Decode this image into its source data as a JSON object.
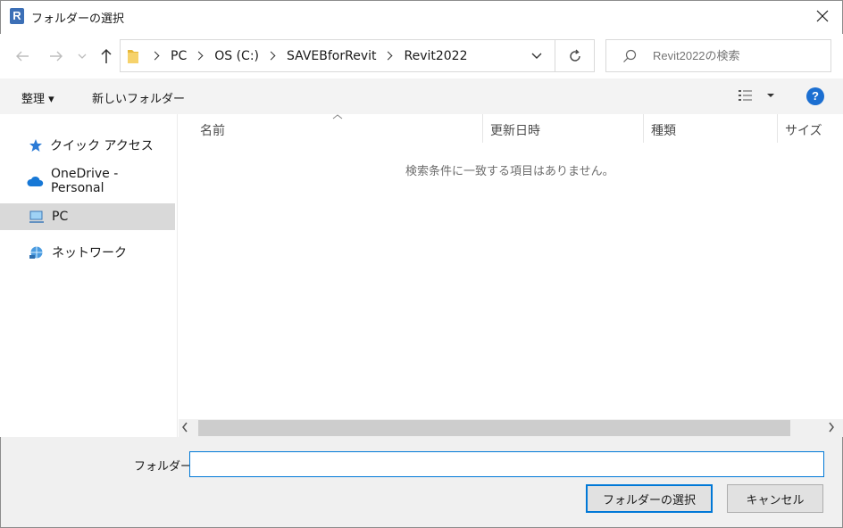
{
  "window": {
    "title": "フォルダーの選択",
    "icon_letter": "R"
  },
  "address": {
    "crumbs": [
      "PC",
      "OS (C:)",
      "SAVEBforRevit",
      "Revit2022"
    ]
  },
  "search": {
    "placeholder": "Revit2022の検索"
  },
  "toolbar": {
    "organize_label": "整理 ▾",
    "new_folder_label": "新しいフォルダー",
    "help_label": "?"
  },
  "sidebar": {
    "items": [
      {
        "label": "クイック アクセス",
        "icon": "star-icon"
      },
      {
        "label": "OneDrive - Personal",
        "icon": "cloud-icon"
      },
      {
        "label": "PC",
        "icon": "computer-icon",
        "selected": true
      },
      {
        "label": "ネットワーク",
        "icon": "network-icon"
      }
    ]
  },
  "columns": {
    "name": "名前",
    "modified": "更新日時",
    "type": "種類",
    "size": "サイズ"
  },
  "list": {
    "empty_message": "検索条件に一致する項目はありません。"
  },
  "footer": {
    "folder_label": "フォルダー:",
    "folder_value": "",
    "select_button": "フォルダーの選択",
    "cancel_button": "キャンセル"
  },
  "colors": {
    "accent": "#0078d7",
    "selected_bg": "#d9d9d9",
    "toolbar_bg": "#f3f3f3",
    "footer_bg": "#f0f0f0"
  }
}
